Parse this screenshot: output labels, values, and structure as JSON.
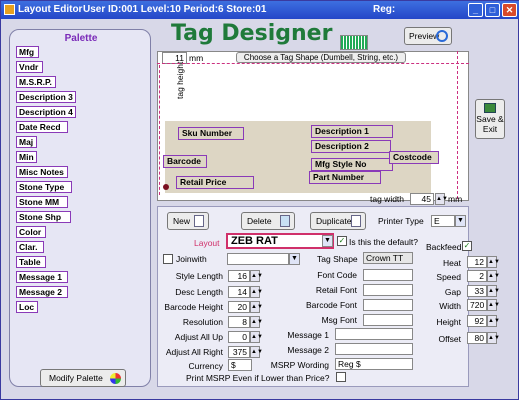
{
  "titlebar": {
    "title": "Layout Editor",
    "info": "User ID:001 Level:10 Period:6 Store:01",
    "reg": "Reg:",
    "minimize": "_",
    "maximize": "□",
    "close": "✕"
  },
  "palette": {
    "title": "Palette",
    "items": [
      "Mfg",
      "Vndr",
      "M.S.R.P.",
      "Description 3",
      "Description 4",
      "Date Recd",
      "Maj",
      "Min",
      "Misc Notes",
      "Stone Type",
      "Stone MM",
      "Stone Shp",
      "Color",
      "Clar.",
      "Table",
      "Message 1",
      "Message 2",
      "Loc"
    ],
    "modify_label": "Modify Palette"
  },
  "designer": {
    "heading": "Tag Designer",
    "preview_label": "Preview",
    "shape_button": "Choose a Tag Shape (Dumbell, String, etc.)",
    "top_value": "11",
    "top_unit": "mm",
    "tag_height_label": "tag height",
    "tag_width_label": "tag width",
    "tag_width_value": "45",
    "tag_width_unit": "mm",
    "save_label_1": "Save &",
    "save_label_2": "Exit",
    "fields": [
      "Sku Number",
      "Description 1",
      "Description 2",
      "Barcode",
      "Mfg Style No",
      "Costcode",
      "Retail Price",
      "Part Number"
    ]
  },
  "controls": {
    "new_label": "New",
    "delete_label": "Delete",
    "duplicate_label": "Duplicate",
    "printer_type_label": "Printer Type",
    "printer_type_value": "E",
    "layout_label": "Layout",
    "layout_value": "ZEB RAT",
    "default_label": "Is this the default?",
    "backfeed_label": "Backfeed",
    "joinwith_label": "Joinwith",
    "tag_shape_label": "Tag Shape",
    "tag_shape_value": "Crown TT",
    "left_fields": [
      {
        "label": "Style Length",
        "value": "16"
      },
      {
        "label": "Desc Length",
        "value": "14"
      },
      {
        "label": "Barcode Height",
        "value": "20"
      },
      {
        "label": "Resolution",
        "value": "8"
      },
      {
        "label": "Adjust All Up",
        "value": "0"
      },
      {
        "label": "Adjust All Right",
        "value": "375"
      }
    ],
    "currency_label": "Currency",
    "currency_value": "$",
    "fonts": [
      "Font Code",
      "Retail Font",
      "Barcode Font",
      "Msg Font"
    ],
    "messages": [
      "Message 1",
      "Message 2"
    ],
    "msrp_label": "MSRP Wording",
    "msrp_value": "Reg $",
    "print_msrp_label": "Print MSRP Even if Lower than Price?",
    "right_fields": [
      {
        "label": "Heat",
        "value": "12"
      },
      {
        "label": "Speed",
        "value": "2"
      },
      {
        "label": "Gap",
        "value": "33"
      },
      {
        "label": "Width",
        "value": "720"
      },
      {
        "label": "Height",
        "value": "92"
      },
      {
        "label": "Offset",
        "value": "80"
      }
    ]
  },
  "colors": {
    "titlebar": "#2a4fd0",
    "heading": "#1f7a3a",
    "palette_title": "#7a2ab8",
    "field_border": "#8a3ab8",
    "layout_border": "#d0306a"
  }
}
